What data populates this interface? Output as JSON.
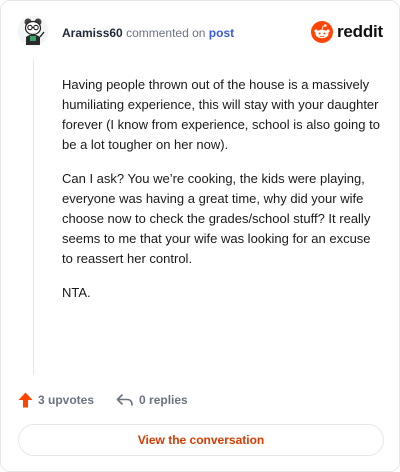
{
  "comment": {
    "author": "Aramiss60",
    "action_text": "commented on",
    "post_link": "post",
    "paragraphs": [
      "Having people thrown out of the house is a massively humiliating experience, this will stay with your daughter forever (I know from experience, school is also going to be a lot tougher on her now).",
      "Can I ask? You we’re cooking, the kids were playing, everyone was having a great time, why did your wife choose now to check the grades/school stuff? It really seems to me that your wife was looking for an excuse to reassert her control.",
      "NTA."
    ]
  },
  "brand": {
    "name": "reddit",
    "icon": "reddit-snoo-icon",
    "color": "#ff4500"
  },
  "footer": {
    "upvotes": "3 upvotes",
    "replies": "0 replies",
    "upvote_color": "#ff4500"
  },
  "cta": {
    "label": "View the conversation",
    "color": "#d93a00"
  }
}
